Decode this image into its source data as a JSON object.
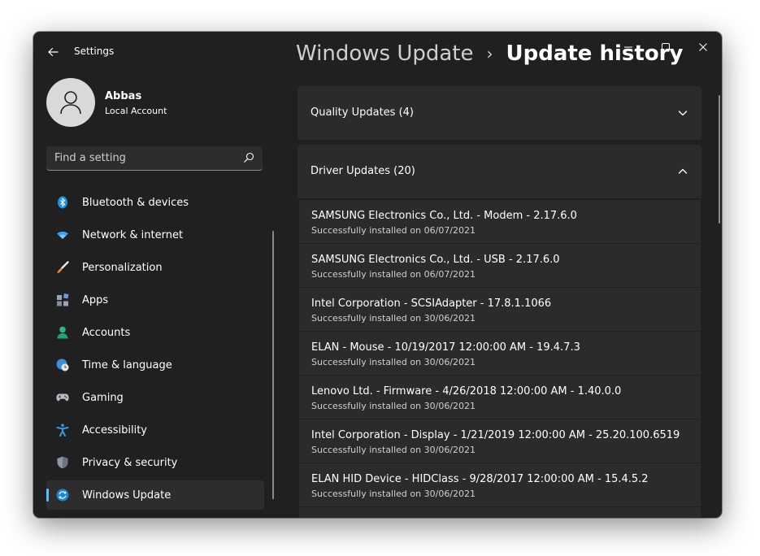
{
  "app": {
    "title": "Settings"
  },
  "user": {
    "name": "Abbas",
    "account_type": "Local Account"
  },
  "search": {
    "placeholder": "Find a setting"
  },
  "sidebar": {
    "items": [
      {
        "label": "Bluetooth & devices",
        "icon": "bluetooth-icon"
      },
      {
        "label": "Network & internet",
        "icon": "wifi-icon"
      },
      {
        "label": "Personalization",
        "icon": "brush-icon"
      },
      {
        "label": "Apps",
        "icon": "apps-icon"
      },
      {
        "label": "Accounts",
        "icon": "person-icon"
      },
      {
        "label": "Time & language",
        "icon": "globe-clock-icon"
      },
      {
        "label": "Gaming",
        "icon": "gamepad-icon"
      },
      {
        "label": "Accessibility",
        "icon": "accessibility-icon"
      },
      {
        "label": "Privacy & security",
        "icon": "shield-icon"
      },
      {
        "label": "Windows Update",
        "icon": "sync-icon",
        "selected": true
      }
    ]
  },
  "breadcrumb": {
    "parent": "Windows Update",
    "separator": "›",
    "current": "Update history"
  },
  "sections": {
    "quality": {
      "title": "Quality Updates (4)",
      "expanded": false
    },
    "driver": {
      "title": "Driver Updates (20)",
      "expanded": true
    }
  },
  "driver_updates": [
    {
      "title": "SAMSUNG Electronics Co., Ltd.  - Modem - 2.17.6.0",
      "status": "Successfully installed on 06/07/2021"
    },
    {
      "title": "SAMSUNG Electronics Co., Ltd.  - USB - 2.17.6.0",
      "status": "Successfully installed on 06/07/2021"
    },
    {
      "title": "Intel Corporation - SCSIAdapter - 17.8.1.1066",
      "status": "Successfully installed on 30/06/2021"
    },
    {
      "title": "ELAN - Mouse - 10/19/2017 12:00:00 AM - 19.4.7.3",
      "status": "Successfully installed on 30/06/2021"
    },
    {
      "title": "Lenovo Ltd. - Firmware - 4/26/2018 12:00:00 AM - 1.40.0.0",
      "status": "Successfully installed on 30/06/2021"
    },
    {
      "title": "Intel Corporation - Display - 1/21/2019 12:00:00 AM - 25.20.100.6519",
      "status": "Successfully installed on 30/06/2021"
    },
    {
      "title": "ELAN HID Device - HIDClass - 9/28/2017 12:00:00 AM - 15.4.5.2",
      "status": "Successfully installed on 30/06/2021"
    }
  ],
  "colors": {
    "accent": "#4cc2ff",
    "window_bg": "#202020",
    "card_bg": "#2b2b2b"
  }
}
